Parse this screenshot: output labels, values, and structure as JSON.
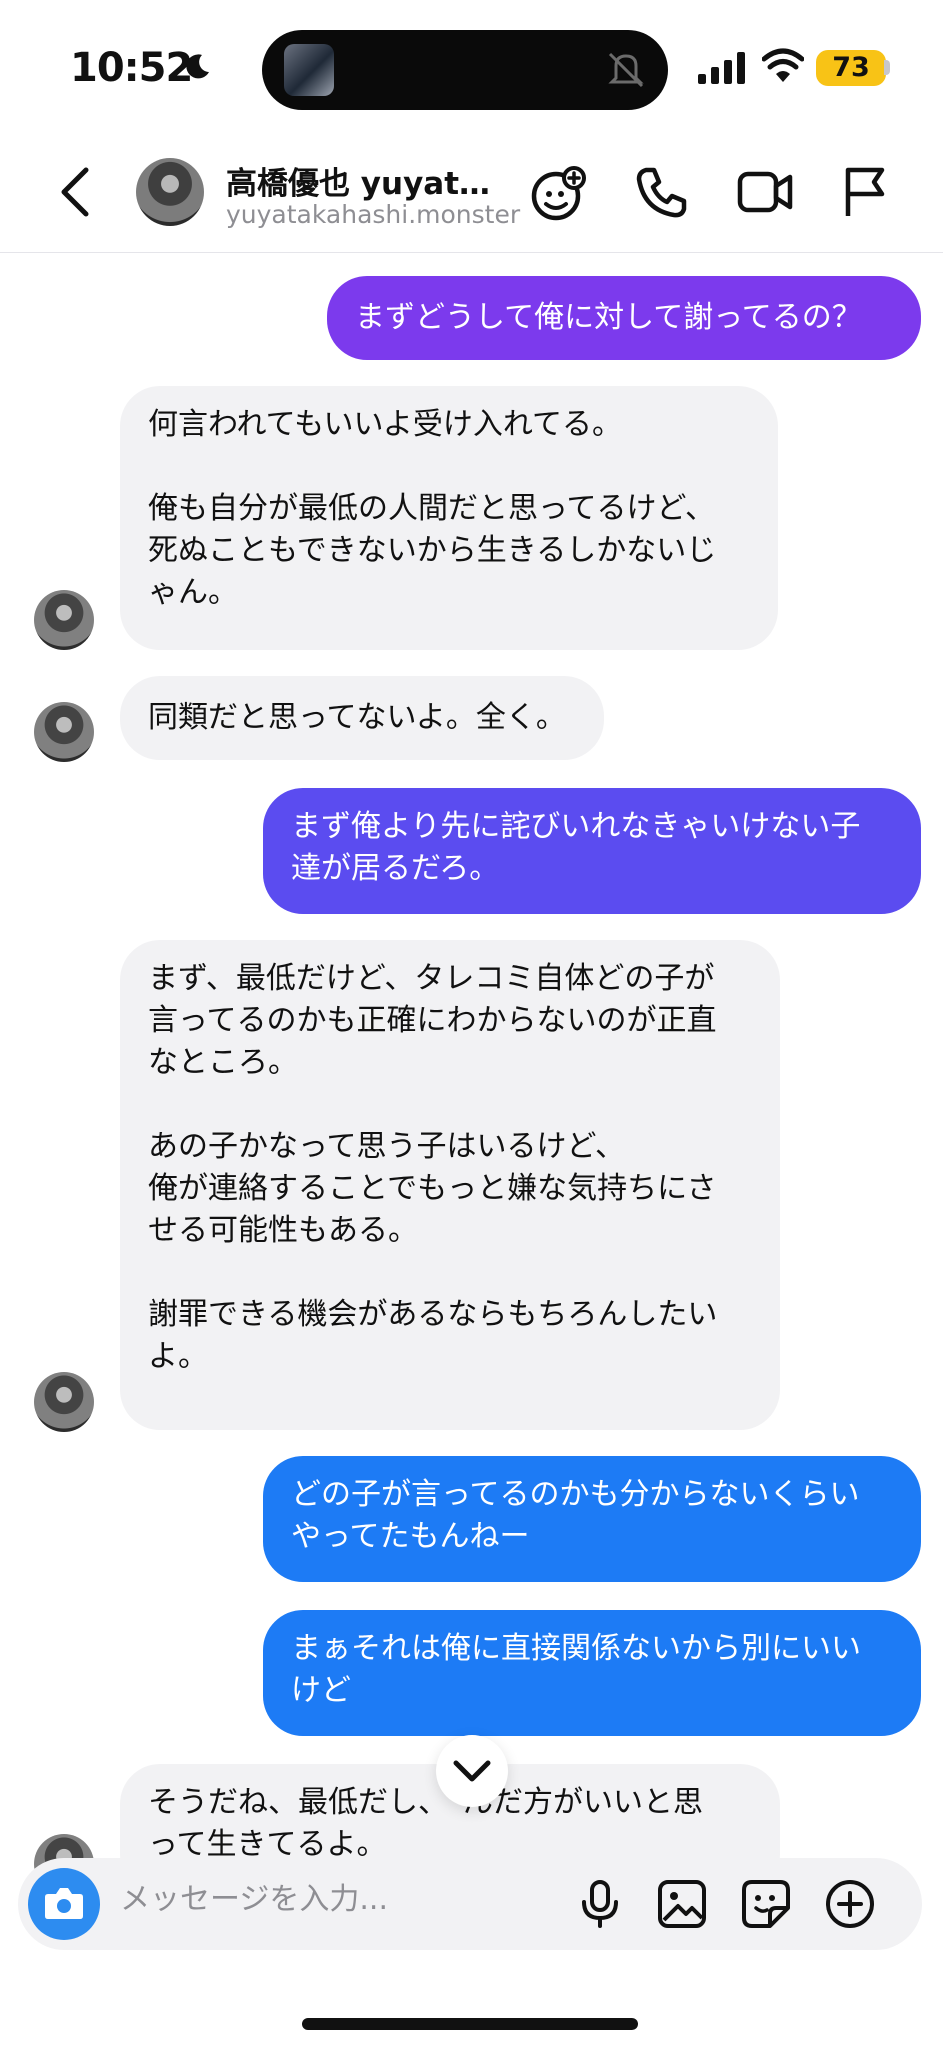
{
  "status_bar": {
    "time": "10:52",
    "battery": "73"
  },
  "header": {
    "name": "高橋優也 yuyatakahashi",
    "handle": "yuyatakahashi.monster"
  },
  "colors": {
    "gradient_top": "#7c3aed",
    "gradient_mid": "#5b4cf0",
    "gradient_bottom": "#1d7bf5",
    "incoming_bubble": "#f2f2f4",
    "battery": "#f8c316"
  },
  "messages": [
    {
      "dir": "out",
      "text": "まずどうして俺に対して謝ってるの？"
    },
    {
      "dir": "in",
      "text": "何言われてもいいよ受け入れてる。\n\n俺も自分が最低の人間だと思ってるけど、\n死ぬこともできないから生きるしかないじ\nゃん。"
    },
    {
      "dir": "in",
      "text": "同類だと思ってないよ。全く。"
    },
    {
      "dir": "out",
      "text": "まず俺より先に詫びいれなきゃいけない子\n達が居るだろ。"
    },
    {
      "dir": "in",
      "text": "まず、最低だけど、タレコミ自体どの子が\n言ってるのかも正確にわからないのが正直\nなところ。\n\nあの子かなって思う子はいるけど、\n俺が連絡することでもっと嫌な気持ちにさ\nせる可能性もある。\n\n謝罪できる機会があるならもちろんしたい\nよ。"
    },
    {
      "dir": "out",
      "text": "どの子が言ってるのかも分からないくらい\nやってたもんねー"
    },
    {
      "dir": "out",
      "text": "まぁそれは俺に直接関係ないから別にいい\nけど"
    },
    {
      "dir": "in",
      "text": "そうだね、最低だし、　んだ方がいいと思\nって生きてるよ。"
    }
  ],
  "composer": {
    "placeholder": "メッセージを入力..."
  },
  "icons": {
    "back": "chevron-left-icon",
    "effects": "sparkle-face-icon",
    "call": "phone-icon",
    "video": "video-icon",
    "report": "flag-icon",
    "camera": "camera-icon",
    "mic": "microphone-icon",
    "gallery": "image-icon",
    "sticker": "sticker-icon",
    "more": "plus-circle-icon",
    "scroll": "chevron-down-icon"
  }
}
